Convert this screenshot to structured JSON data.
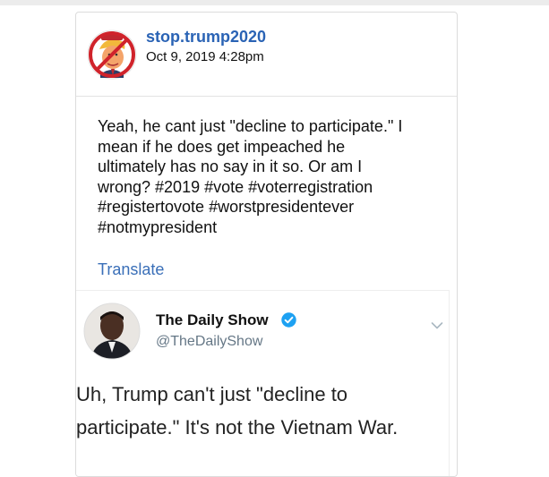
{
  "post": {
    "username": "stop.trump2020",
    "date": "Oct 9, 2019 4:28pm",
    "avatar_icon": "no-trump-sign-icon",
    "body_lines": [
      "Yeah, he cant just \"decline to participate.\" I",
      "mean if he does get impeached he",
      "ultimately has no say in it so. Or am I",
      "wrong? #2019 #vote #voterregistration",
      "#registertovote #worstpresidentever",
      "#notmypresident"
    ],
    "translate_label": "Translate"
  },
  "embedded_tweet": {
    "name": "The Daily Show",
    "handle": "@TheDailyShow",
    "verified_icon": "verified-badge-icon",
    "menu_icon": "chevron-down-icon",
    "text_lines": [
      "Uh, Trump can't just \"decline to",
      "participate.\" It's not the Vietnam War."
    ]
  },
  "colors": {
    "link": "#2a63b5",
    "translate": "#3a6fb8",
    "verified": "#1da1f2",
    "handle": "#657786"
  }
}
